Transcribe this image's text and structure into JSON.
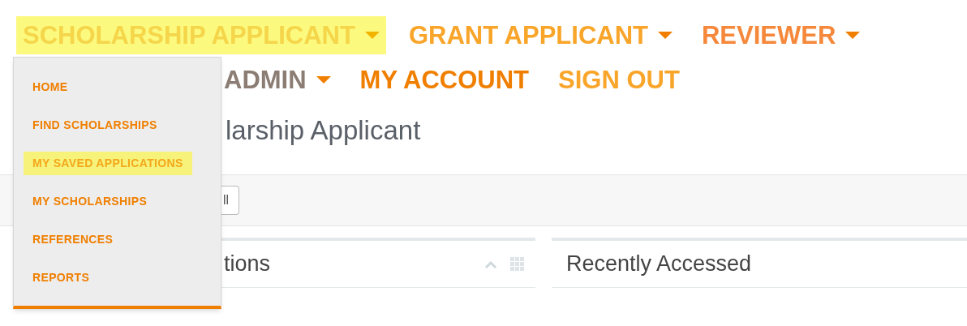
{
  "nav": {
    "primary": [
      {
        "label": "SCHOLARSHIP APPLICANT",
        "dropdown": true,
        "highlighted": true,
        "color": "#f5d54a"
      },
      {
        "label": "GRANT APPLICANT",
        "dropdown": true,
        "highlighted": false,
        "color": "#f9a52a"
      },
      {
        "label": "REVIEWER",
        "dropdown": true,
        "highlighted": false,
        "color": "#f5883a"
      }
    ],
    "secondary": [
      {
        "label": "ADMIN",
        "dropdown": true,
        "highlighted": false,
        "color": "#8b7d74"
      },
      {
        "label": "MY ACCOUNT",
        "dropdown": false,
        "highlighted": false,
        "color": "#f07f00"
      },
      {
        "label": "SIGN OUT",
        "dropdown": false,
        "highlighted": false,
        "color": "#f9a52a"
      }
    ]
  },
  "dropdown_menu": {
    "items": [
      {
        "label": "HOME",
        "highlighted": false
      },
      {
        "label": "FIND SCHOLARSHIPS",
        "highlighted": false
      },
      {
        "label": "MY SAVED APPLICATIONS",
        "highlighted": true
      },
      {
        "label": "MY SCHOLARSHIPS",
        "highlighted": false
      },
      {
        "label": "REFERENCES",
        "highlighted": false
      },
      {
        "label": "REPORTS",
        "highlighted": false
      }
    ]
  },
  "page_title": "larship Applicant",
  "toolbar": {
    "button": "ll"
  },
  "panels": [
    {
      "title": "tions",
      "controls": true
    },
    {
      "title": "Recently Accessed",
      "controls": false
    }
  ]
}
